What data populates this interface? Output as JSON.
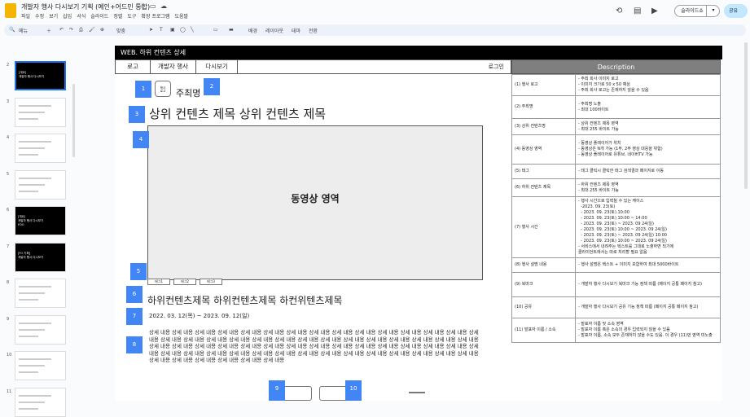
{
  "app": {
    "title": "개발자 행사 다시보기 기획 (예인+어드민 통합)",
    "menus": [
      "파일",
      "수정",
      "보기",
      "삽입",
      "서식",
      "슬라이드",
      "정렬",
      "도구",
      "확장 프로그램",
      "도움말"
    ],
    "slideshow_label": "슬라이드쇼",
    "share_label": "공유"
  },
  "toolbar": {
    "search_label": "메뉴",
    "zoom_label": "맞춤",
    "background": "배경",
    "layout": "레이아웃",
    "theme": "테마",
    "transition": "전환"
  },
  "filmstrip": [
    {
      "num": "2",
      "dark": true,
      "text": "[개요]\n개발자 행사 다시보기"
    },
    {
      "num": "3",
      "dark": false,
      "text": ""
    },
    {
      "num": "4",
      "dark": false,
      "text": ""
    },
    {
      "num": "5",
      "dark": false,
      "text": ""
    },
    {
      "num": "6",
      "dark": true,
      "text": "[개요]\n개발자 행사 다시보기\nFOO"
    },
    {
      "num": "7",
      "dark": true,
      "text": "[FO 기획]\n개발자 행사 다시보기"
    },
    {
      "num": "8",
      "dark": false,
      "text": ""
    },
    {
      "num": "9",
      "dark": false,
      "text": ""
    },
    {
      "num": "10",
      "dark": false,
      "text": ""
    },
    {
      "num": "11",
      "dark": false,
      "text": ""
    }
  ],
  "slide": {
    "header": "WEB. 하위 컨텐츠 상세",
    "nav": {
      "logo": "로고",
      "event": "개발자 행사",
      "replay": "다시보기",
      "login": "로그인"
    },
    "logo_box": "행사\n로고",
    "host": "주최명",
    "content_title": "상위 컨텐츠 제목 상위 컨텐츠 제목",
    "video_label": "동영상 영역",
    "tags": [
      "태그1",
      "태그2",
      "태그3"
    ],
    "subtitle": "하위컨텐츠제목 하위컨텐츠제목 하컨위텐츠제목",
    "date_range": "2022. 03. 12(목) ~ 2023. 09. 12(일)",
    "body_text": "상세 내용 상세 내용 상세 내용 상세 내용 상세 내용 상세 내용 상세 내용 상세 내용 상세 내용 상세 내용 상세 내용 상세 내용 상세 내용 상세 내용 상세 내용 상세 내용 상세 내용 상세 내용 상세 내용 상세 내용 상세 내용 상세 내용 상세 내용 상세 내용 상세 내용 상세 내용 상세 내용 상세 내용 상세 내용 상세 내용 상세 내용 상세 내용 상세 내용 상세 내용 상세 내용 상세 내용 상세 내용 상세 내용 상세 내용 상세 내용 상세 내용 상세 내용 상세 내용 상세 내용 상세 내용 상세 내용 상세 내용 상세 내용 상세 내용 상세 내용 상세 내용 상세 내용 상세 내용 상세 내용 상세 내용 상세 내용 상세 내용 상세 내용 상세 내용 상세 내용 상세 내용 상세 내용 상세 내용 상세 내용",
    "badges": [
      "1",
      "2",
      "3",
      "4",
      "5",
      "6",
      "7",
      "8",
      "9",
      "10"
    ],
    "description_header": "Description",
    "description": [
      {
        "key": "(1) 행사 로고",
        "lines": [
          "- 주최 회사 이미지 로고",
          "- 이미지 크기로 50 x 50 예상",
          "- 주최 회사 로고는 존재하지 않을 수 있음"
        ]
      },
      {
        "key": "(2) 주최명",
        "lines": [
          "- 주최명 노출",
          "- 최대 100바이트"
        ]
      },
      {
        "key": "(3) 상위 컨텐츠명",
        "lines": [
          "- 상위 컨텐츠 제목 영역",
          "- 최대 255 바이트 가능"
        ]
      },
      {
        "key": "(4) 동영상 영역",
        "lines": [
          "- 동영상 플레이어가 위치",
          "- 동영상은 N개 가능 (1부, 2부 영상 대응을 위함)",
          "- 동영상 플레이어로 유튜브, 네이버TV 가능"
        ]
      },
      {
        "key": "(5) 태그",
        "lines": [
          "- 태그 클릭시 클릭한 태그 검색결과 페이지로 이동"
        ]
      },
      {
        "key": "(6) 하위 컨텐츠 제목",
        "lines": [
          "- 하위 컨텐츠 제목 영역",
          "- 최대 255 바이트 가능"
        ]
      },
      {
        "key": "(7) 행사 시간",
        "lines": [
          "- 행사 시간으로 입력될 수 있는 케이스",
          "  -2023. 09. 23(토)",
          "  - 2023. 09. 23(토) 10:00",
          "  - 2023. 09. 23(토) 10:00 ~ 14:00",
          "  - 2023. 09. 23(토) ~ 2023. 09 24(일)",
          "  - 2023. 09. 23(토) 10:00 ~ 2023. 09 24(일)",
          "  - 2023. 09. 23(토) ~ 2023. 09 24(일) 10:00",
          "  - 2023. 09. 23(토) 10:00 ~ 2023. 09 24(일)",
          "- 서비스에서 내려주는 텍스트를 그대로 노출하면 되기에",
          "클라이언트에서는 따로 처리할 필요 없음"
        ]
      },
      {
        "key": "(8) 행사 설명 내용",
        "lines": [
          "- 행사 설명은 텍스트 + 이미지 포함하여 최대 5000바이트"
        ]
      },
      {
        "key": "(9) 북마크",
        "lines": [
          "- 개발자 행사 다시보기 북마크 기능 정책 따름 (페이지 공통 페이지 참고)"
        ]
      },
      {
        "key": "(10) 공유",
        "lines": [
          "- 개발자 행사 다시보기 공유 기능 정책 따름 (페이지 공통 페이지 참고)"
        ]
      },
      {
        "key": "(11) 발표자 이름 / 소속",
        "lines": [
          "- 발표자 이름 및 소속 영역",
          "- 발표자 이름 혹은 소속의 경우 입력되지 않을 수 있음",
          "- 발표자 이름, 소속 모두 존재하지 않을 수도 있음. 이 경우 (11)번 영역 미노출"
        ]
      }
    ]
  }
}
